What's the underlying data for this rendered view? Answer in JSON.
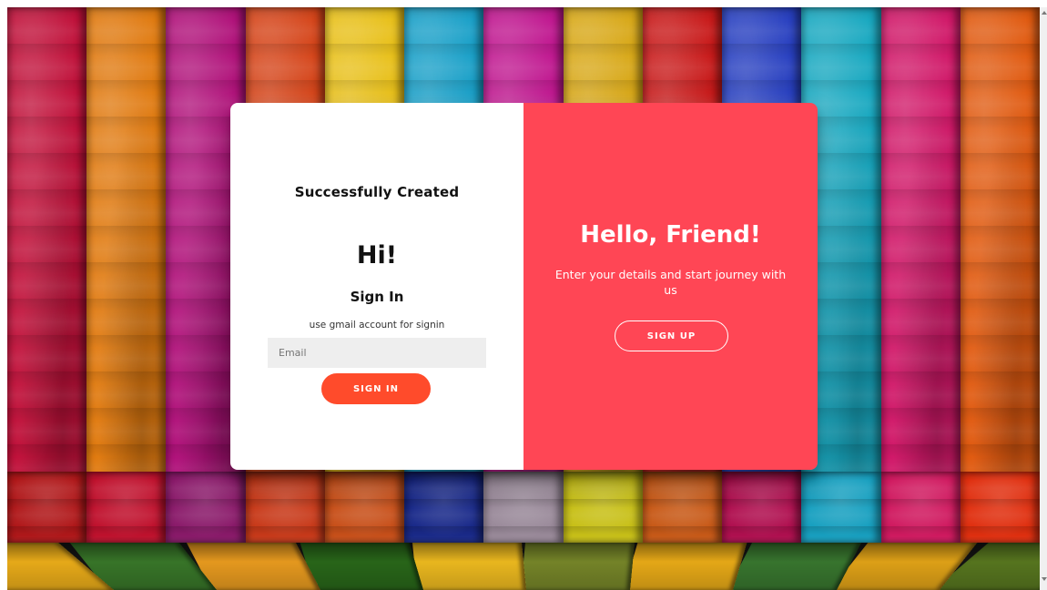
{
  "background": {
    "wall_colors": [
      "#c0113a",
      "#e07a10",
      "#b0127a",
      "#d5451a",
      "#e8c01a",
      "#1aa0c8",
      "#c01890",
      "#d8a818",
      "#c81a1a",
      "#2840c0",
      "#18a8c0",
      "#d01868",
      "#e05a10"
    ],
    "floor_colors": [
      "#f2b21a",
      "#3a7a2a",
      "#f0a020",
      "#2a6a1a",
      "#f5c020",
      "#7a8a2a",
      "#f0b018",
      "#3a7a30",
      "#e8a818",
      "#5a7a20"
    ]
  },
  "left_panel": {
    "status": "Successfully Created",
    "greeting": "Hi!",
    "title": "Sign In",
    "hint": "use gmail account for signin",
    "email_placeholder": "Email",
    "email_value": "",
    "sign_in_label": "SIGN IN"
  },
  "right_panel": {
    "heading": "Hello, Friend!",
    "text": "Enter your details and start journey with us",
    "sign_up_label": "SIGN UP"
  },
  "colors": {
    "accent": "#ff4655",
    "button": "#ff4b2b",
    "input_bg": "#eeeeee"
  }
}
